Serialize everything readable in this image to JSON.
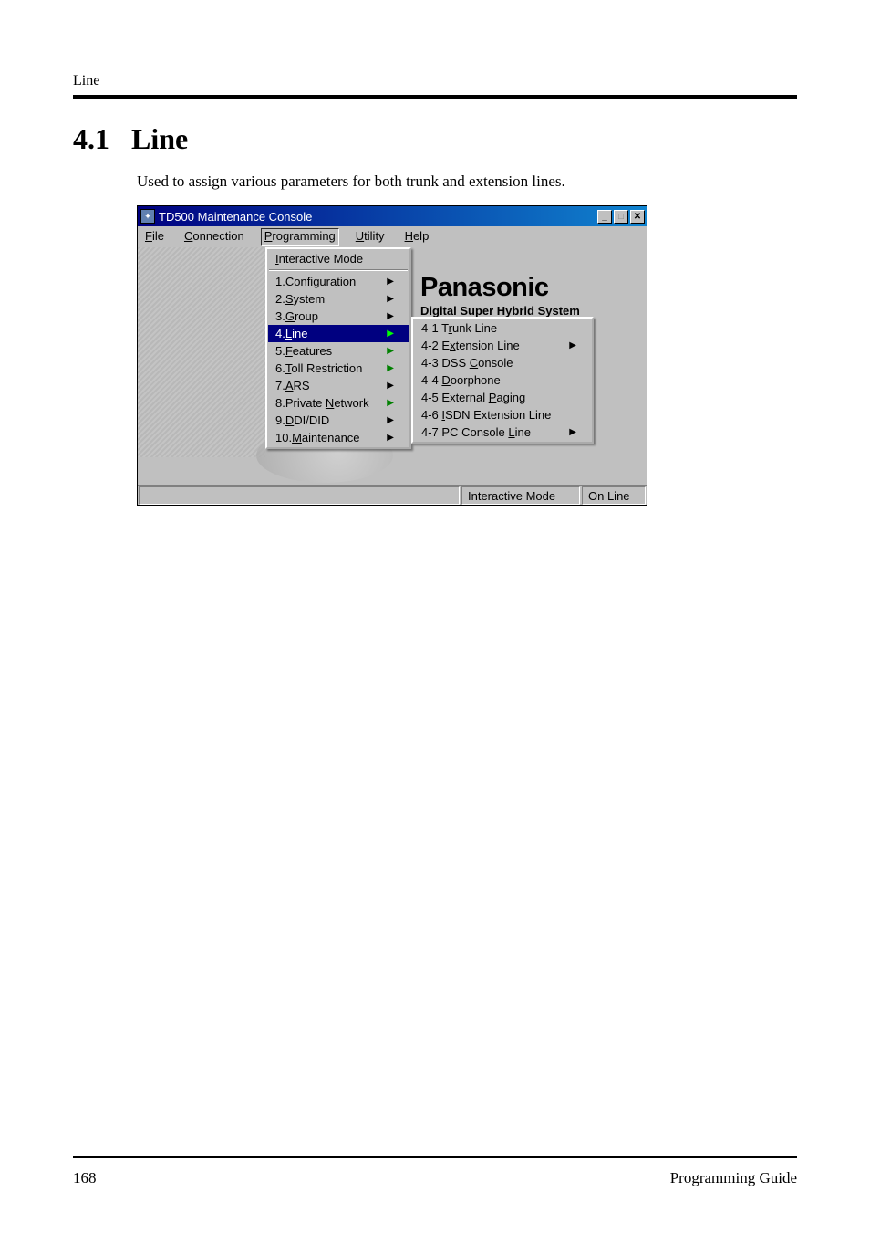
{
  "page": {
    "header": "Line",
    "section_number": "4.1",
    "section_title": "Line",
    "description": "Used to assign various parameters for both trunk and extension lines.",
    "page_number": "168",
    "footer_right": "Programming Guide"
  },
  "window": {
    "title": "TD500 Maintenance Console",
    "menubar": {
      "file": "File",
      "connection": "Connection",
      "programming": "Programming",
      "utility": "Utility",
      "help": "Help"
    },
    "brand": "Panasonic",
    "brand_sub": "Digital Super Hybrid System",
    "programming_menu": {
      "interactive_mode": "Interactive Mode",
      "items": [
        "1.Configuration",
        "2.System",
        "3.Group",
        "4.Line",
        "5.Features",
        "6.Toll Restriction",
        "7.ARS",
        "8.Private Network",
        "9.DDI/DID",
        "10.Maintenance"
      ]
    },
    "line_submenu": {
      "items": [
        "4-1 Trunk Line",
        "4-2 Extension Line",
        "4-3 DSS Console",
        "4-4 Doorphone",
        "4-5 External Paging",
        "4-6 ISDN Extension Line",
        "4-7 PC Console Line"
      ]
    },
    "status": {
      "mode": "Interactive Mode",
      "connection": "On Line"
    }
  }
}
